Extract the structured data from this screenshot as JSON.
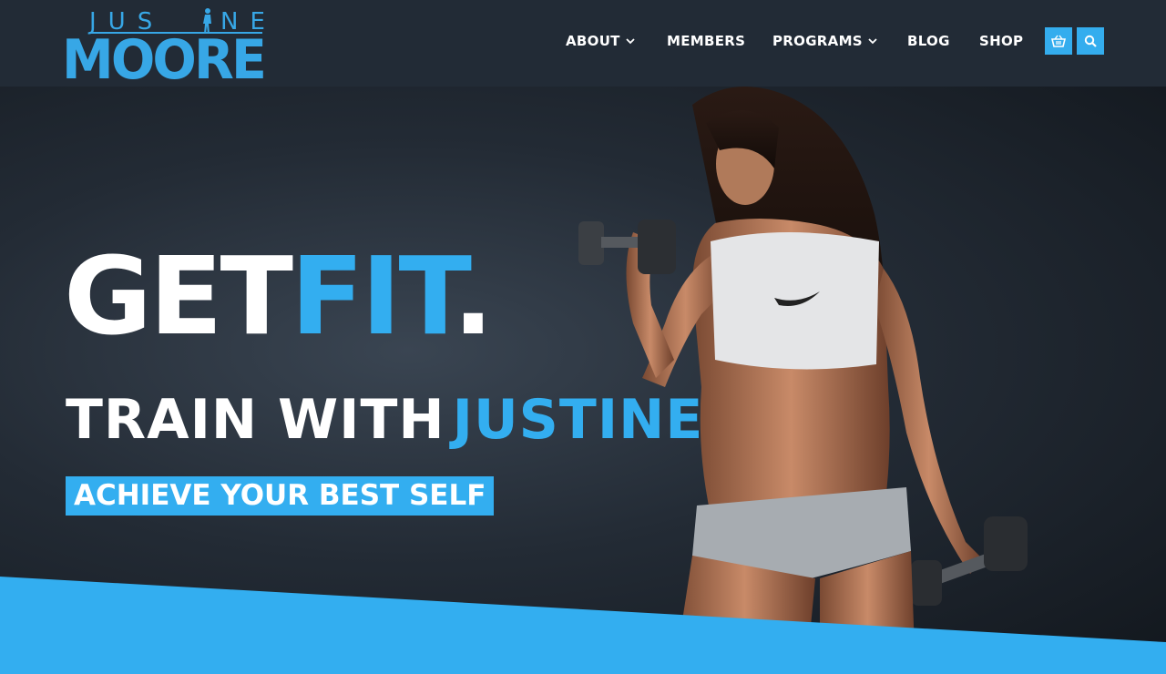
{
  "brand": {
    "logo_top": "JUSTINE",
    "logo_bottom": "MOORE",
    "accent": "#33aef0",
    "header_bg": "#222b36"
  },
  "nav": {
    "items": [
      {
        "label": "ABOUT",
        "has_dropdown": true
      },
      {
        "label": "MEMBERS",
        "has_dropdown": false
      },
      {
        "label": "PROGRAMS",
        "has_dropdown": true
      },
      {
        "label": "BLOG",
        "has_dropdown": false
      },
      {
        "label": "SHOP",
        "has_dropdown": false
      }
    ],
    "icons": [
      "basket-icon",
      "search-icon"
    ]
  },
  "hero": {
    "headline_white": "GET",
    "headline_blue": "FIT",
    "headline_dot": ".",
    "sub_white": "TRAIN WITH",
    "sub_blue": "JUSTINE",
    "badge": "ACHIEVE YOUR BEST SELF"
  }
}
